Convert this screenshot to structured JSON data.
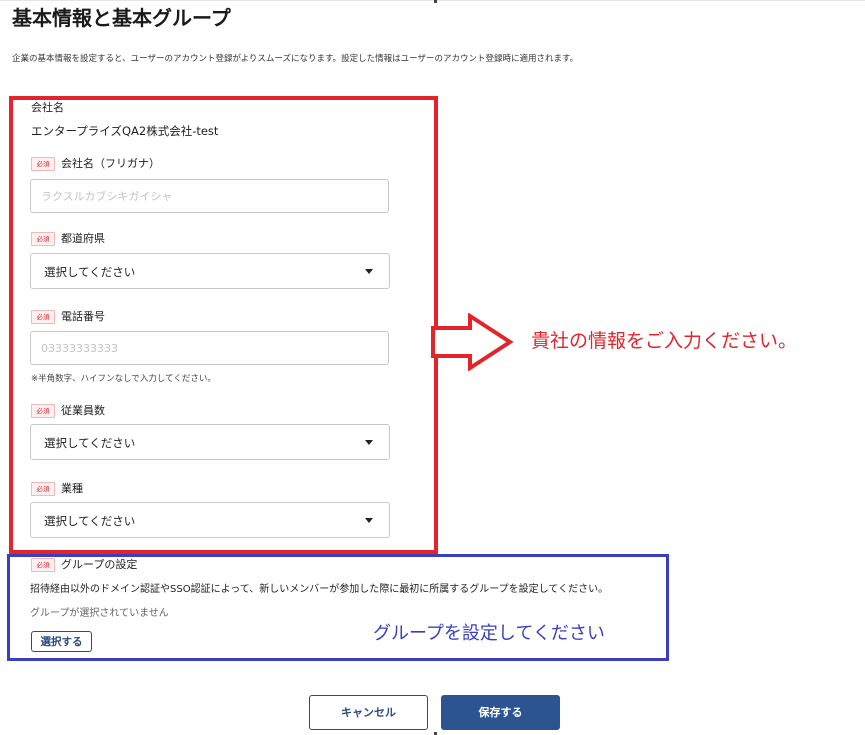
{
  "header": {
    "title": "基本情報と基本グループ",
    "description": "企業の基本情報を設定すると、ユーザーのアカウント登録がよりスムーズになります。設定した情報はユーザーのアカウント登録時に適用されます。"
  },
  "form": {
    "required_badge": "必須",
    "company_name": {
      "label": "会社名",
      "value": "エンタープライズQA2株式会社-test"
    },
    "company_kana": {
      "label": "会社名（フリガナ）",
      "placeholder": "ラクスルカブシキガイシャ"
    },
    "prefecture": {
      "label": "都道府県",
      "selected": "選択してください"
    },
    "phone": {
      "label": "電話番号",
      "placeholder": "03333333333",
      "hint": "※半角数字、ハイフンなしで入力してください。"
    },
    "employees": {
      "label": "従業員数",
      "selected": "選択してください"
    },
    "industry": {
      "label": "業種",
      "selected": "選択してください"
    }
  },
  "group": {
    "title": "グループの設定",
    "description": "招待経由以外のドメイン認証やSSO認証によって、新しいメンバーが参加した際に最初に所属するグループを設定してください。",
    "none_selected": "グループが選択されていません",
    "select_button": "選択する"
  },
  "annotations": {
    "red_text": "貴社の情報をご入力ください。",
    "blue_text": "グループを設定してください",
    "red_color": "#e3242b",
    "blue_color": "#3a3fbf"
  },
  "footer": {
    "cancel_label": "キャンセル",
    "save_label": "保存する"
  },
  "colors": {
    "primary": "#2c5491",
    "required": "#e3242b"
  }
}
